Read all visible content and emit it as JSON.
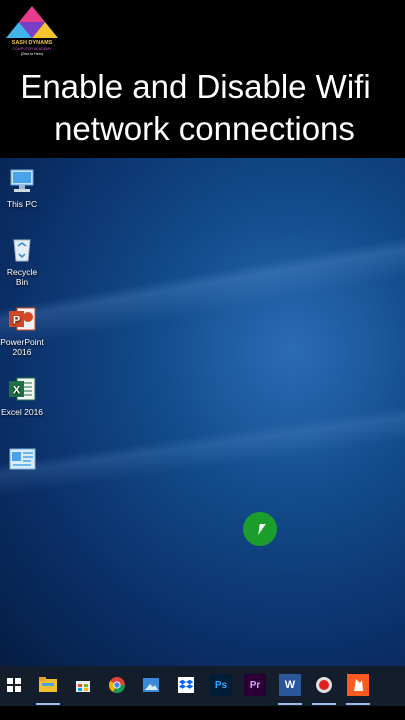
{
  "logo": {
    "line1": "SASH DYNAMS",
    "line2": "COMPUTER ACADEMY",
    "line3": "(Zero to Hero)"
  },
  "title": {
    "line1": "Enable and Disable Wifi",
    "line2": "network connections"
  },
  "desktop_icons": [
    {
      "label": "This PC",
      "icon": "this-pc-icon"
    },
    {
      "label": "Recycle Bin",
      "icon": "recycle-bin-icon"
    },
    {
      "label": "PowerPoint 2016",
      "icon": "powerpoint-icon"
    },
    {
      "label": "Excel 2016",
      "icon": "excel-icon"
    },
    {
      "label": "",
      "icon": "control-panel-icon"
    }
  ],
  "taskbar": {
    "start_glyph": "⊞",
    "apps": [
      {
        "name": "file-explorer",
        "glyph": "",
        "color": "#f0c030"
      },
      {
        "name": "store",
        "glyph": "",
        "color": "#e8eef8"
      },
      {
        "name": "chrome",
        "glyph": "",
        "color": "#e04030"
      },
      {
        "name": "photos",
        "glyph": "",
        "color": "#3a8ad8"
      },
      {
        "name": "dropbox",
        "glyph": "",
        "color": "#0061fe"
      },
      {
        "name": "photoshop",
        "glyph": "Ps",
        "color": "#31a8ff"
      },
      {
        "name": "premiere",
        "glyph": "Pr",
        "color": "#d9a0ff"
      },
      {
        "name": "word",
        "glyph": "W",
        "color": "#2b579a"
      },
      {
        "name": "recorder",
        "glyph": "",
        "color": "#e0e0e0"
      },
      {
        "name": "app",
        "glyph": "",
        "color": "#ff5a1f"
      }
    ]
  }
}
